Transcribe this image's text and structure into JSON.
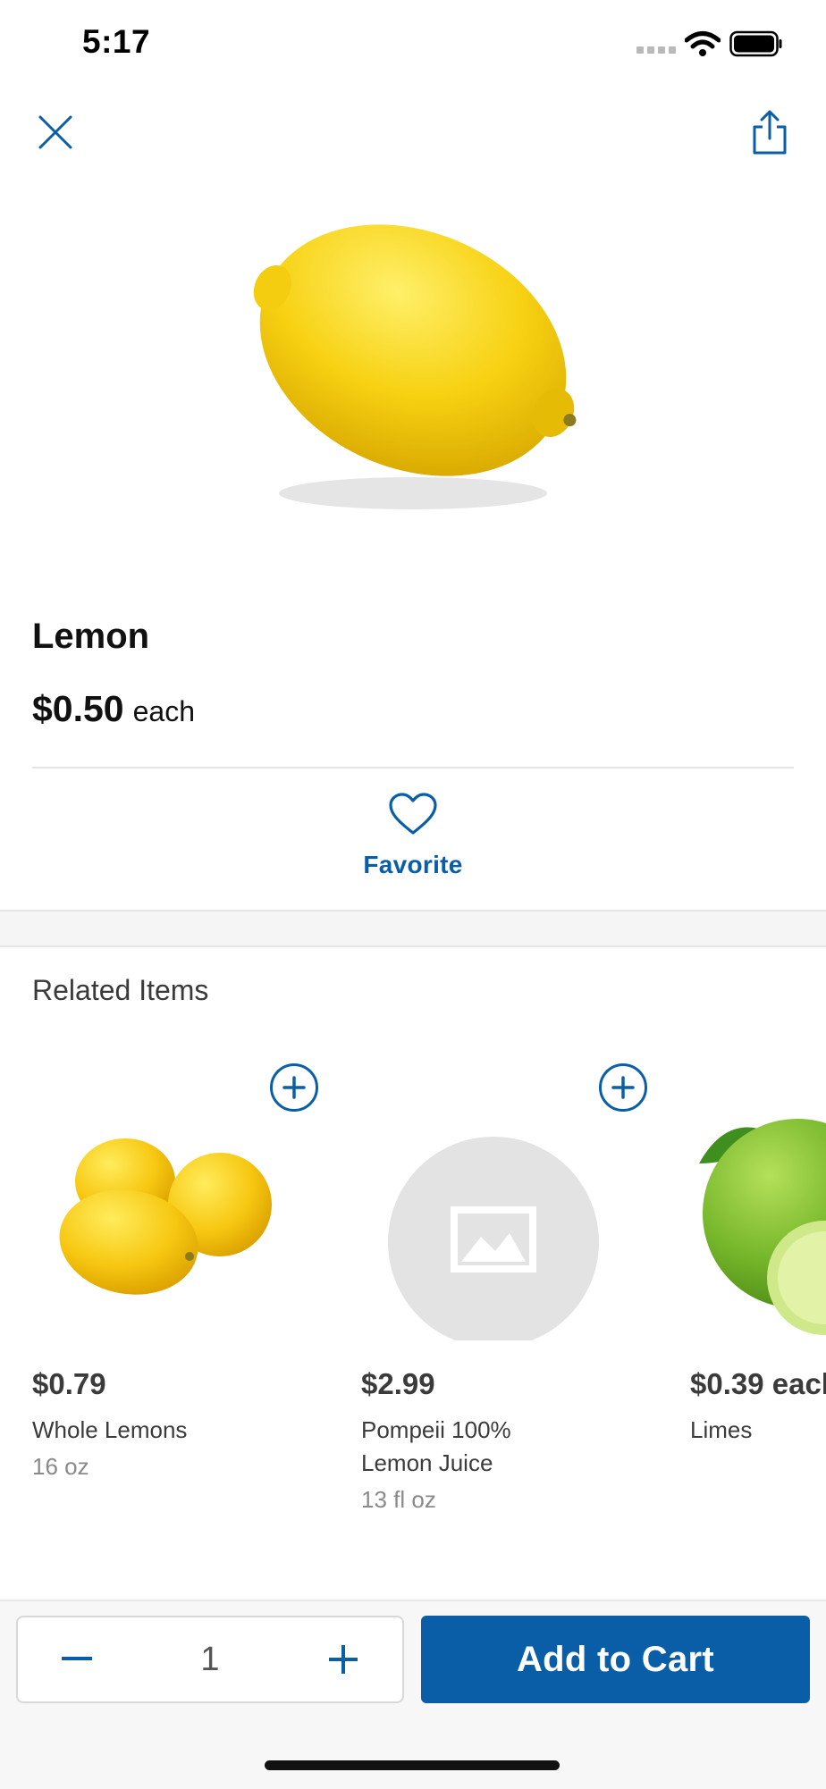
{
  "status_bar": {
    "time": "5:17"
  },
  "header": {
    "close_icon": "close-icon",
    "share_icon": "share-icon"
  },
  "product": {
    "name": "Lemon",
    "price": "$0.50",
    "unit": "each",
    "image_icon": "lemon-image"
  },
  "favorite": {
    "label": "Favorite",
    "icon": "heart-icon"
  },
  "related": {
    "heading": "Related Items",
    "items": [
      {
        "price": "$0.79",
        "name": "Whole Lemons",
        "size": "16 oz",
        "image": "lemons-image"
      },
      {
        "price": "$2.99",
        "name": "Pompeii 100% Lemon Juice",
        "size": "13 fl oz",
        "image": "placeholder-image"
      },
      {
        "price": "$0.39 each",
        "name": "Limes",
        "size": "",
        "image": "limes-image"
      }
    ]
  },
  "bottom_bar": {
    "quantity": "1",
    "add_to_cart_label": "Add to Cart"
  },
  "colors": {
    "accent": "#0a5ea8",
    "lemon": "#f6cf0f",
    "lime": "#7cbd2c"
  }
}
